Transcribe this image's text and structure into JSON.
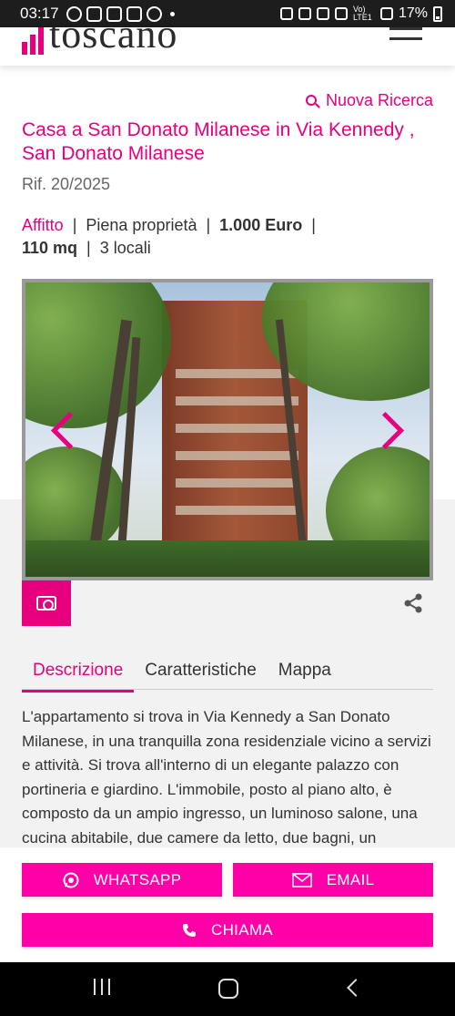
{
  "status_bar": {
    "time": "03:17",
    "network": "Vo) LTE1",
    "battery": "17%"
  },
  "header": {
    "logo_text": "toscano",
    "menu_icon": "hamburger-icon"
  },
  "listing": {
    "new_search": "Nuova Ricerca",
    "title": "Casa a San Donato Milanese in Via Kennedy , San Donato Milanese",
    "ref": "Rif. 20/2025",
    "contract": "Affitto",
    "ownership": "Piena proprietà",
    "price": "1.000 Euro",
    "area": "110 mq",
    "rooms": "3 locali"
  },
  "gallery": {
    "prev_icon": "chevron-left-icon",
    "next_icon": "chevron-right-icon",
    "photos_icon": "camera-icon",
    "share_icon": "share-icon"
  },
  "tabs": [
    {
      "label": "Descrizione",
      "active": true
    },
    {
      "label": "Caratteristiche",
      "active": false
    },
    {
      "label": "Mappa",
      "active": false
    }
  ],
  "description": "L'appartamento si trova in Via Kennedy a San Donato Milanese, in una tranquilla zona residenziale vicino a servizi e attività. Si trova all'interno di un elegante palazzo con portineria e giardino. L'immobile, posto al piano alto, è composto da un ampio ingresso, un luminoso salone, una cucina abitabile, due camere da letto, due bagni, un",
  "actions": {
    "whatsapp": "WHATSAPP",
    "email": "EMAIL",
    "call": "CHIAMA"
  },
  "colors": {
    "accent": "#e6007e",
    "button": "#ff00a8"
  }
}
